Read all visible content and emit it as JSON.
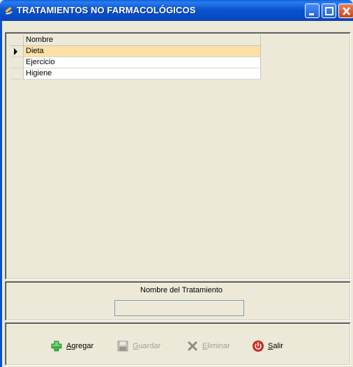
{
  "window": {
    "title": "TRATAMIENTOS NO FARMACOLÓGICOS"
  },
  "grid": {
    "column_header": "Nombre",
    "rows": [
      {
        "nombre": "Dieta",
        "selected": true
      },
      {
        "nombre": "Ejercicio",
        "selected": false
      },
      {
        "nombre": "Higiene",
        "selected": false
      }
    ]
  },
  "form": {
    "label": "Nombre del Tratamiento",
    "value": ""
  },
  "toolbar": {
    "agregar": {
      "accel": "A",
      "rest": "gregar",
      "icon": "add-icon",
      "enabled": true
    },
    "guardar": {
      "accel": "G",
      "rest": "uardar",
      "icon": "save-icon",
      "enabled": false
    },
    "eliminar": {
      "accel": "E",
      "rest": "liminar",
      "icon": "delete-icon",
      "enabled": false
    },
    "salir": {
      "accel": "S",
      "rest": "alir",
      "icon": "exit-icon",
      "enabled": true
    }
  },
  "colors": {
    "titlebar": "#0a55d0",
    "selected_row": "#fce0a8",
    "face": "#ece9d8"
  }
}
